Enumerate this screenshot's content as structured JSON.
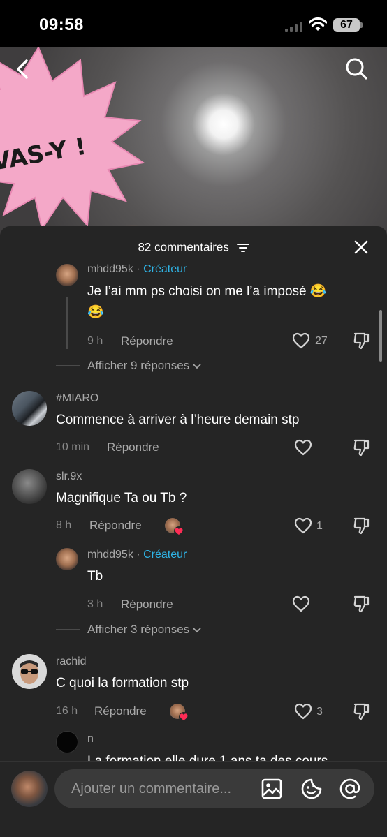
{
  "status_bar": {
    "time": "09:58",
    "battery": "67"
  },
  "video": {
    "sticker_text": "VAS-Y !"
  },
  "sheet": {
    "title": "82 commentaires"
  },
  "comments": [
    {
      "user": "mhdd95k",
      "separator": "·",
      "badge": "Créateur",
      "text_line1": "Je l’ai mm ps choisi on me l’a imposé 😂",
      "text_line2": "😂",
      "time": "9 h",
      "reply": "Répondre",
      "likes": "27"
    },
    {
      "user": "#MIARO",
      "text": "Commence à arriver à l’heure demain stp",
      "time": "10 min",
      "reply": "Répondre"
    },
    {
      "user": "slr.9x",
      "text": "Magnifique Ta ou Tb ?",
      "time": "8 h",
      "reply": "Répondre",
      "likes": "1"
    },
    {
      "user": "mhdd95k",
      "separator": "·",
      "badge": "Créateur",
      "text": "Tb",
      "time": "3 h",
      "reply": "Répondre"
    },
    {
      "user": "rachid",
      "text": "C quoi la formation stp",
      "time": "16 h",
      "reply": "Répondre",
      "likes": "3"
    },
    {
      "user": "n",
      "text": "La formation elle dure 1 ans ta des cours"
    }
  ],
  "show_more": [
    "Afficher 9 réponses",
    "Afficher 3 réponses"
  ],
  "input": {
    "placeholder": "Ajouter un commentaire..."
  },
  "colors": {
    "sheet_bg": "#252525",
    "accent": "#2fb4e6",
    "heart": "#fe2c55",
    "sticker": "#f4a8c8"
  }
}
